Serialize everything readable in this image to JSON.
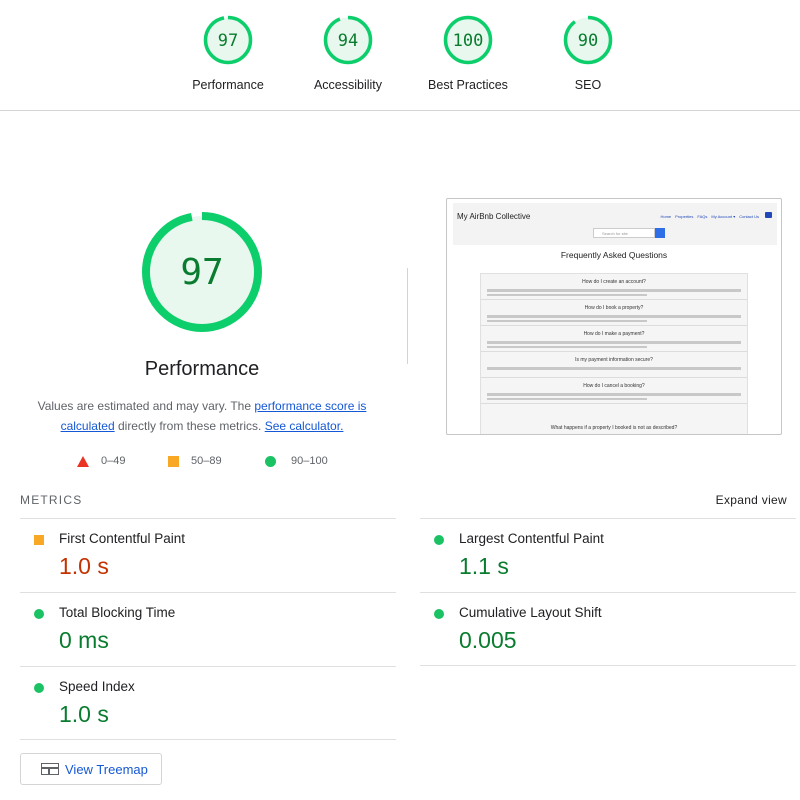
{
  "colors": {
    "pass": "#0a7c2f",
    "pass_ring": "#0cce6b",
    "pass_fill": "#e8f8ef",
    "average": "#f9a825",
    "fail": "#eb3323",
    "link": "#1558d6"
  },
  "summary": [
    {
      "score": 97,
      "label": "Performance"
    },
    {
      "score": 94,
      "label": "Accessibility"
    },
    {
      "score": 100,
      "label": "Best Practices"
    },
    {
      "score": 90,
      "label": "SEO"
    }
  ],
  "performance": {
    "score": 97,
    "title": "Performance",
    "desc_pre": "Values are estimated and may vary. The ",
    "desc_link1": "performance score is calculated",
    "desc_mid": " directly from these metrics. ",
    "desc_link2": "See calculator."
  },
  "legend": [
    {
      "icon": "triangle",
      "range": "0–49"
    },
    {
      "icon": "square",
      "range": "50–89"
    },
    {
      "icon": "circle",
      "range": "90–100"
    }
  ],
  "thumbnail": {
    "brand": "My AirBnb Collective",
    "nav": [
      "Home",
      "Properties",
      "FAQs",
      "My Account ▾",
      "Contact Us"
    ],
    "search_placeholder": "Search for site",
    "heading": "Frequently Asked Questions",
    "questions": [
      "How do I create an account?",
      "How do I book a property?",
      "How do I make a payment?",
      "Is my payment information secure?",
      "How do I cancel a booking?"
    ],
    "last_question": "What happens if a property I booked is not as described?"
  },
  "metrics": {
    "title": "METRICS",
    "expand_label": "Expand view",
    "items": [
      {
        "name": "First Contentful Paint",
        "value": "1.0 s",
        "rating": "average"
      },
      {
        "name": "Largest Contentful Paint",
        "value": "1.1 s",
        "rating": "pass"
      },
      {
        "name": "Total Blocking Time",
        "value": "0 ms",
        "rating": "pass"
      },
      {
        "name": "Cumulative Layout Shift",
        "value": "0.005",
        "rating": "pass"
      },
      {
        "name": "Speed Index",
        "value": "1.0 s",
        "rating": "pass"
      }
    ]
  },
  "treemap_label": "View Treemap"
}
